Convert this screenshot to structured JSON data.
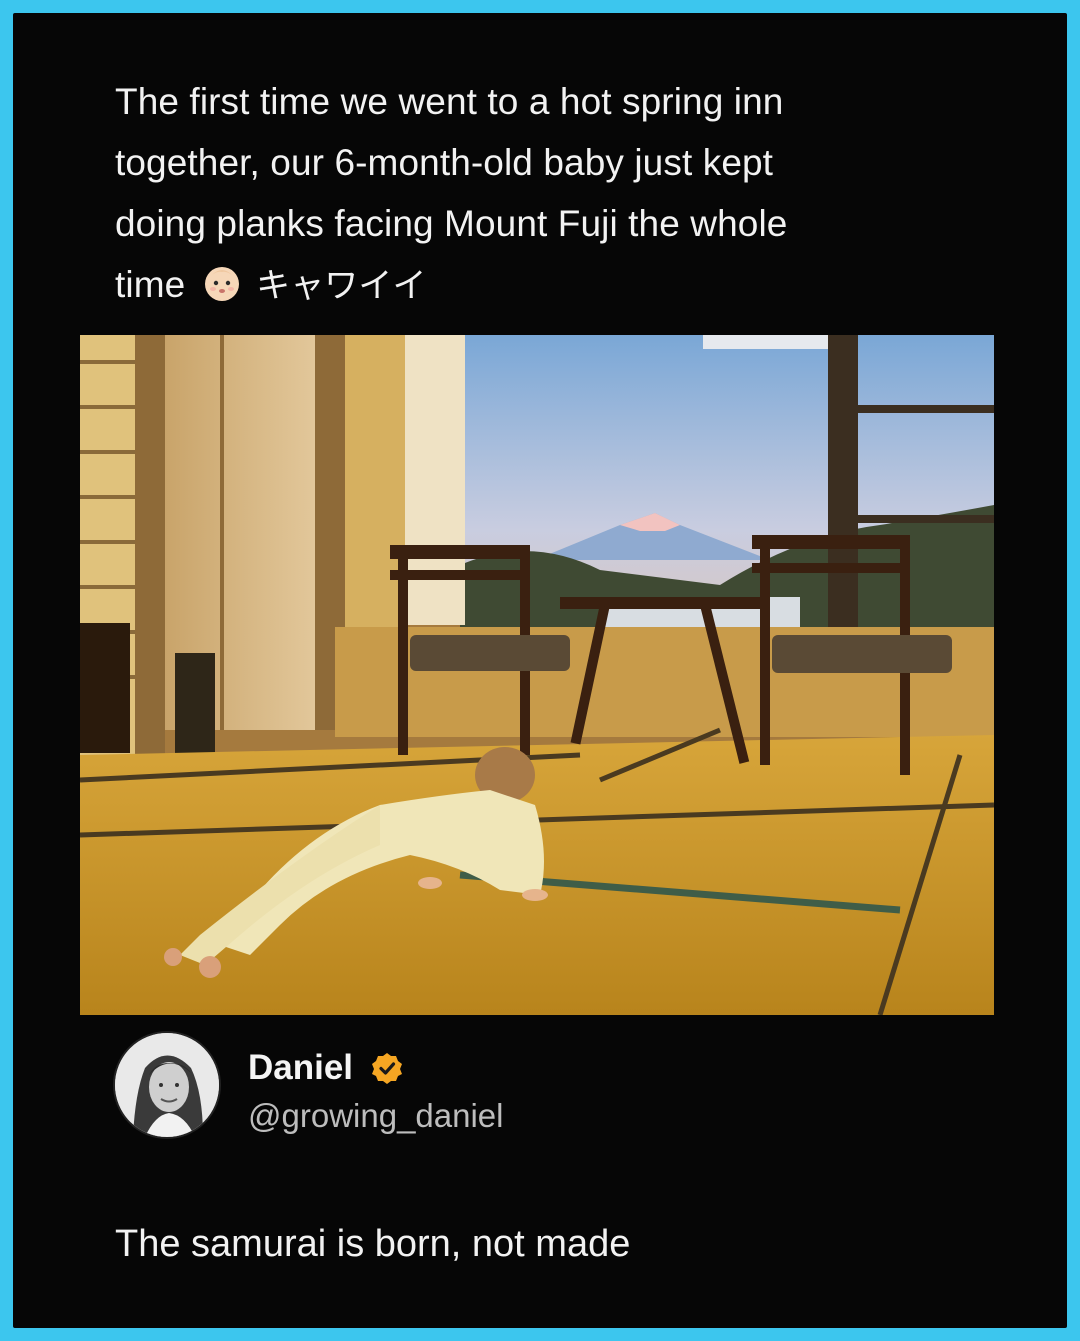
{
  "post": {
    "text_line1": "The first time we went to a hot spring inn",
    "text_line2": "together, our 6-month-old baby just kept",
    "text_line3": "doing planks facing Mount Fuji the whole",
    "text_line4": "time",
    "emoji_icon": "baby-face-emoji",
    "text_suffix": "キャワイイ"
  },
  "author": {
    "name": "Daniel",
    "handle": "@growing_daniel",
    "verified_color": "#f5a623"
  },
  "reply": {
    "text": "The samurai is born, not made"
  },
  "colors": {
    "border": "#3cc6ee",
    "background": "#060606"
  }
}
